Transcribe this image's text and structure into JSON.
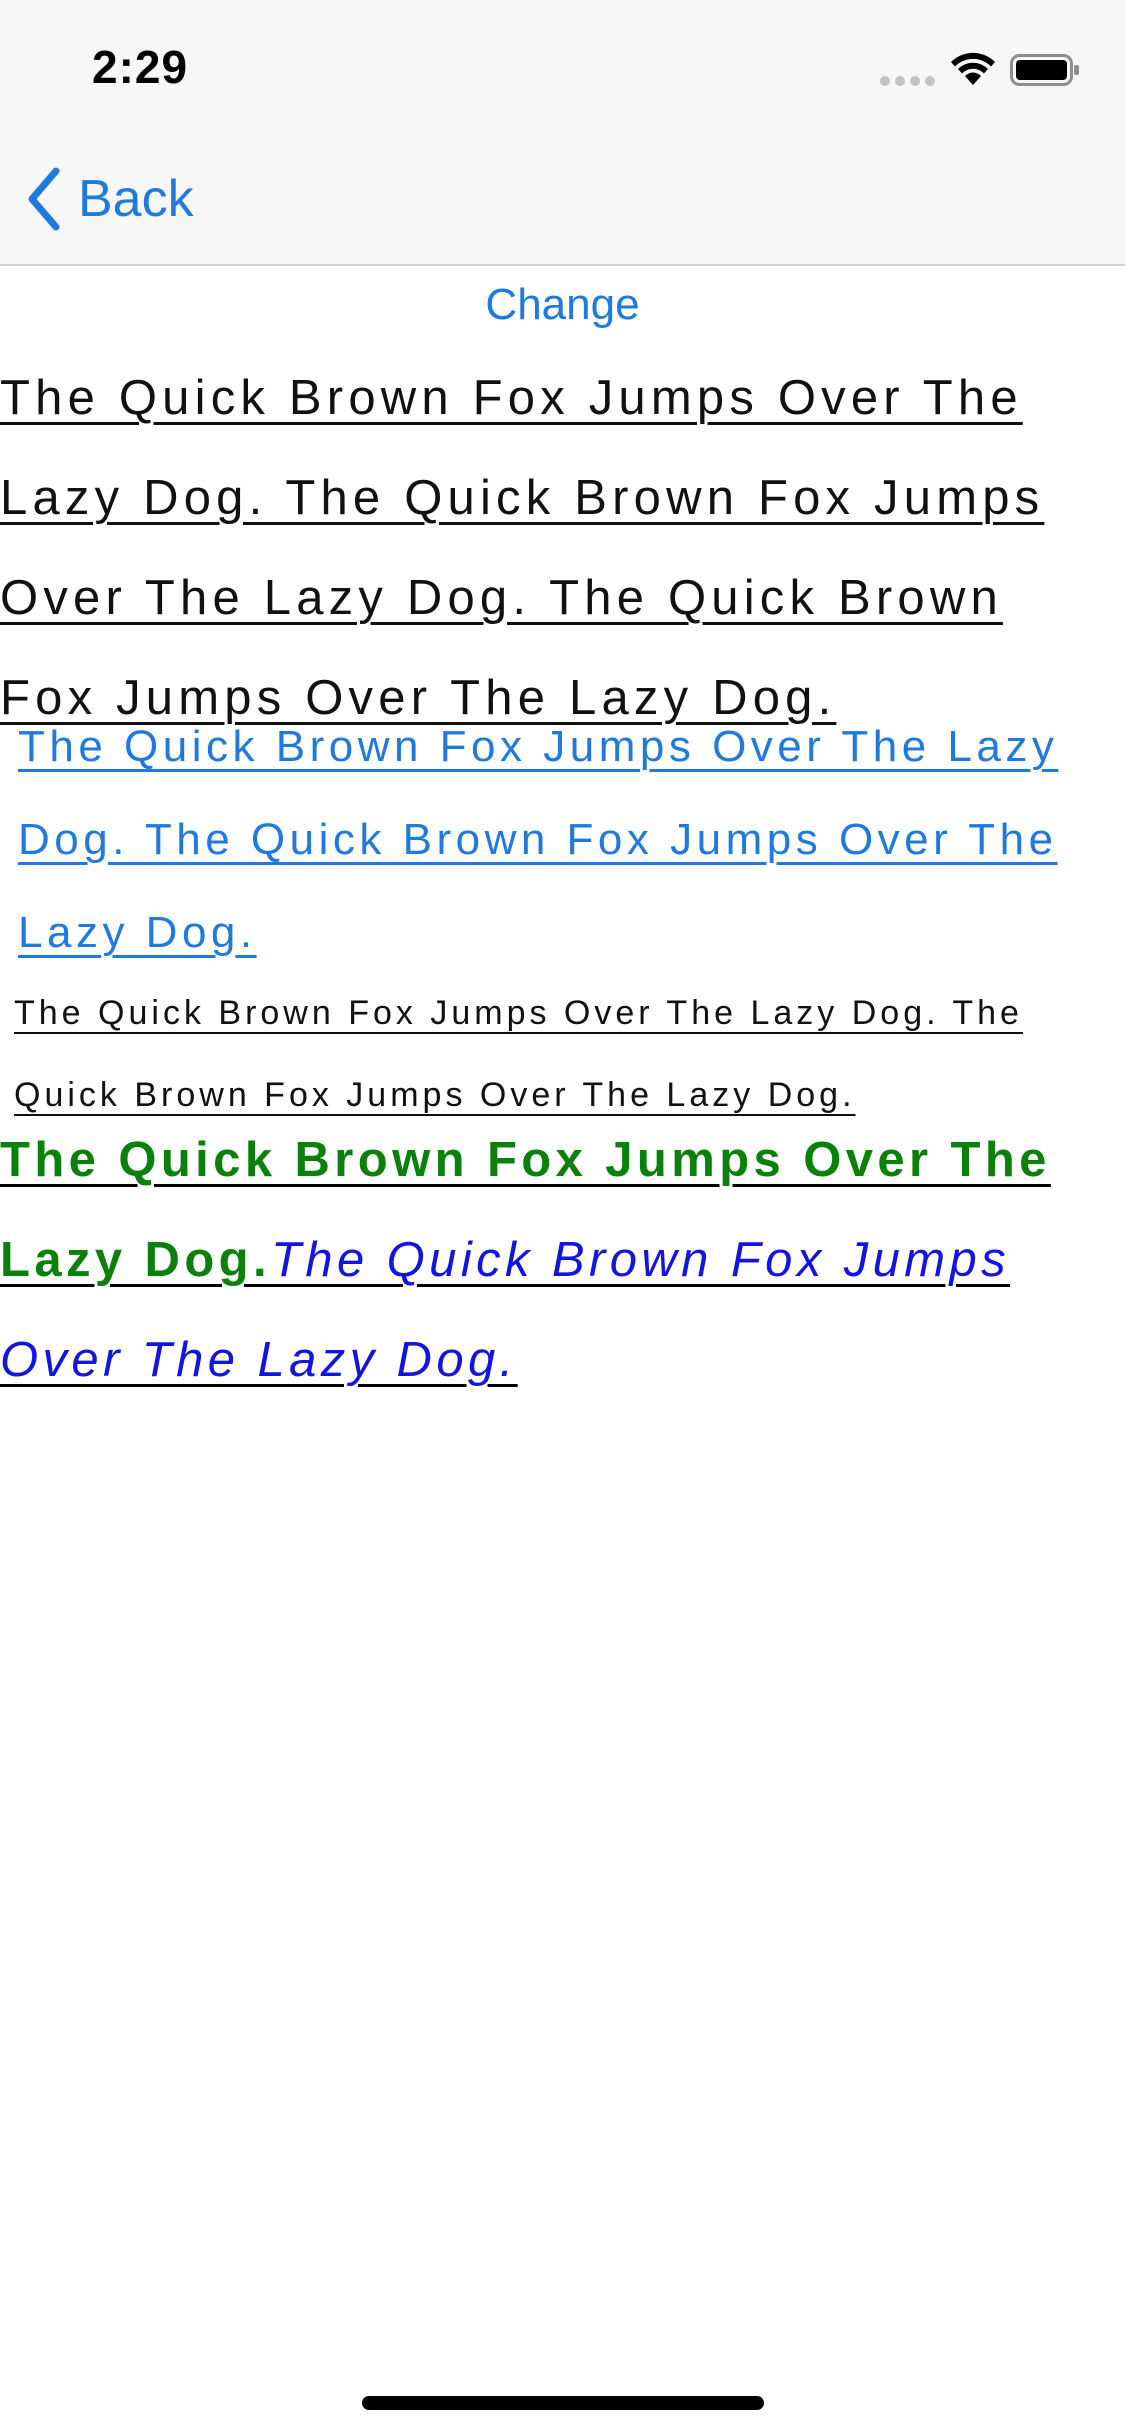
{
  "status_bar": {
    "time": "2:29"
  },
  "nav": {
    "back_label": "Back"
  },
  "change_label": "Change",
  "paragraphs": {
    "large_black": "The Quick Brown Fox Jumps Over The Lazy Dog. The Quick Brown Fox Jumps Over The Lazy Dog. The Quick Brown Fox Jumps Over The Lazy Dog.",
    "medium_blue": "The Quick Brown Fox Jumps Over The Lazy Dog. The Quick Brown Fox Jumps Over The Lazy Dog.",
    "small_black": "The Quick Brown Fox Jumps Over The Lazy Dog. The Quick Brown Fox Jumps Over The Lazy Dog.",
    "mixed_bold_green": "The Quick Brown Fox Jumps Over The Lazy Dog.",
    "mixed_italic_blue": "The Quick Brown Fox Jumps Over The Lazy Dog."
  },
  "colors": {
    "accent_blue": "#1f7ae0",
    "green": "#0b800b",
    "link_blue": "#1414e0",
    "nav_background": "#f7f7f7"
  },
  "icons": {
    "signal": "cellular-signal-icon",
    "wifi": "wifi-icon",
    "battery": "battery-icon",
    "back": "chevron-left-icon"
  }
}
